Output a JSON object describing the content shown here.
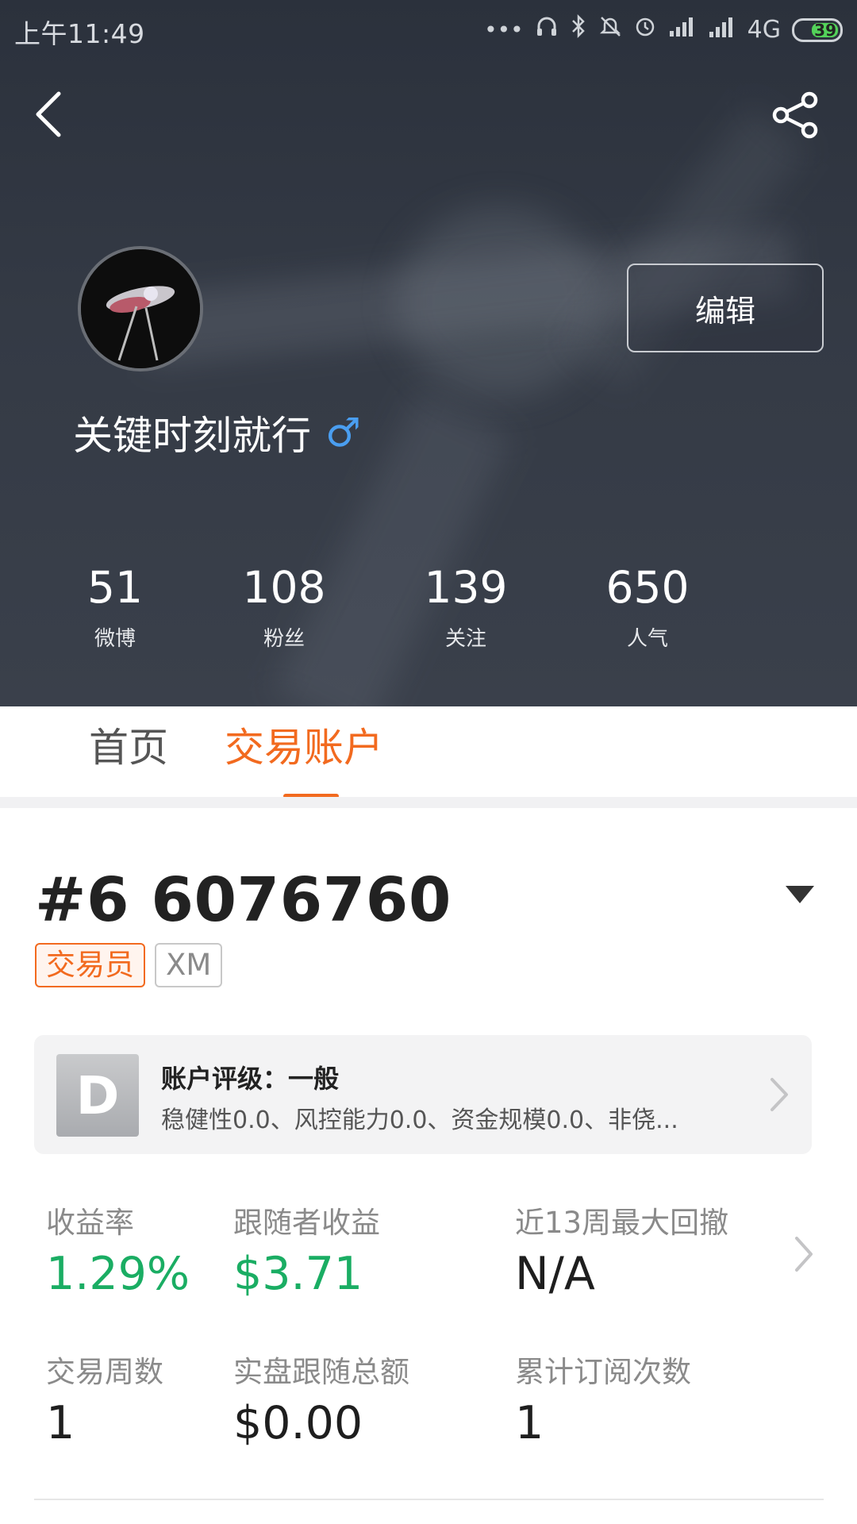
{
  "status_bar": {
    "time": "上午11:49",
    "icons": [
      "more-dots-icon",
      "headphones-icon",
      "bluetooth-icon",
      "mute-icon",
      "alarm-icon",
      "signal-icon",
      "hd-signal-icon"
    ],
    "network": "4G",
    "battery": "39",
    "battery_color": "#53d25a"
  },
  "header": {
    "back_icon": "back-arrow-icon",
    "share_icon": "share-icon",
    "edit_label": "编辑",
    "username": "关键时刻就行",
    "gender_symbol": "♂",
    "stats": [
      {
        "value": "51",
        "label": "微博"
      },
      {
        "value": "108",
        "label": "粉丝"
      },
      {
        "value": "139",
        "label": "关注"
      },
      {
        "value": "650",
        "label": "人气"
      }
    ]
  },
  "tabs": [
    {
      "label": "首页",
      "active": false
    },
    {
      "label": "交易账户",
      "active": true
    }
  ],
  "accent_color": "#f26a1f",
  "positive_color": "#1aad63",
  "account": {
    "id": "#6 6076760",
    "tags": [
      "交易员",
      "XM"
    ],
    "rating": {
      "grade": "D",
      "title": "账户评级：一般",
      "description": "稳健性0.0、风控能力0.0、资金规模0.0、非侥..."
    },
    "metrics": [
      {
        "label": "收益率",
        "value": "1.29%"
      },
      {
        "label": "跟随者收益",
        "value": "$3.71"
      },
      {
        "label": "近13周最大回撤",
        "value": "N/A"
      },
      {
        "label": "交易周数",
        "value": "1"
      },
      {
        "label": "实盘跟随总额",
        "value": "$0.00"
      },
      {
        "label": "累计订阅次数",
        "value": "1"
      }
    ]
  }
}
